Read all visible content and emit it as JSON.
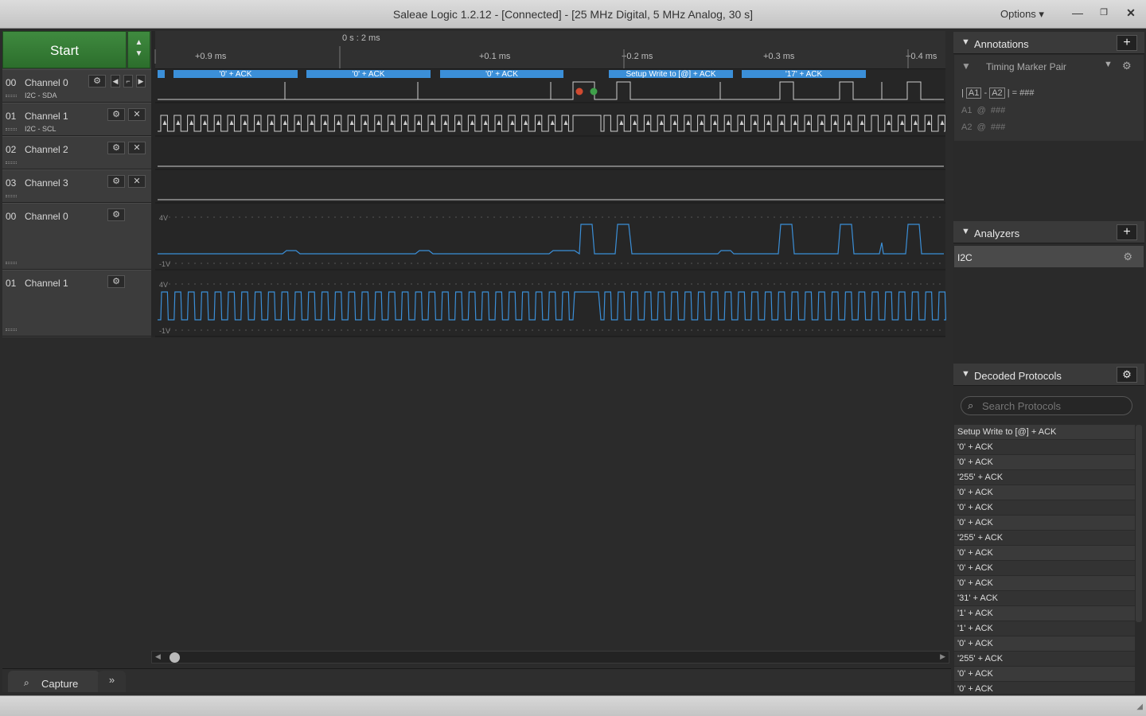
{
  "window": {
    "title": "Saleae Logic 1.2.12 - [Connected] - [25 MHz Digital, 5 MHz Analog, 30 s]",
    "options_label": "Options ▾"
  },
  "start": {
    "label": "Start"
  },
  "timeline": {
    "origin": "0 s : 2 ms",
    "ticks": [
      "+0.9 ms",
      "+0.1 ms",
      "+0.2 ms",
      "+0.3 ms",
      "+0.4 ms"
    ]
  },
  "channels": [
    {
      "num": "00",
      "name": "Channel 0",
      "sub": "I2C - SDA",
      "color": "#b0b0b0"
    },
    {
      "num": "01",
      "name": "Channel 1",
      "sub": "I2C - SCL",
      "color": "#8a4a1a"
    },
    {
      "num": "02",
      "name": "Channel 2",
      "sub": "",
      "color": "#cc2020"
    },
    {
      "num": "03",
      "name": "Channel 3",
      "sub": "",
      "color": "#e08a10"
    },
    {
      "num": "00",
      "name": "Channel 0",
      "sub": "",
      "color": "#b0b0b0"
    },
    {
      "num": "01",
      "name": "Channel 1",
      "sub": "",
      "color": "#8a4a1a"
    }
  ],
  "decode_bubbles": [
    "'0' + ACK",
    "'0' + ACK",
    "'0' + ACK",
    "Setup Write to [@] + ACK",
    "'17' + ACK"
  ],
  "analog": {
    "high_label": "4V",
    "low_label": "-1V"
  },
  "capture": {
    "tab_label": "Capture",
    "more": "»"
  },
  "annotations": {
    "header": "Annotations",
    "marker": "Timing Marker Pair",
    "a1": "A1",
    "a2": "A2",
    "eq": "= ###",
    "a1_row": "A1  @  ###",
    "a2_row": "A2  @  ###"
  },
  "analyzers": {
    "header": "Analyzers",
    "items": [
      "I2C"
    ]
  },
  "decoded": {
    "header": "Decoded Protocols",
    "search_placeholder": "Search Protocols",
    "rows": [
      "Setup Write to [@] + ACK",
      "'0' + ACK",
      "'0' + ACK",
      "'255' + ACK",
      "'0' + ACK",
      "'0' + ACK",
      "'0' + ACK",
      "'255' + ACK",
      "'0' + ACK",
      "'0' + ACK",
      "'0' + ACK",
      "'31' + ACK",
      "'1' + ACK",
      "'1' + ACK",
      "'0' + ACK",
      "'255' + ACK",
      "'0' + ACK",
      "'0' + ACK"
    ]
  }
}
